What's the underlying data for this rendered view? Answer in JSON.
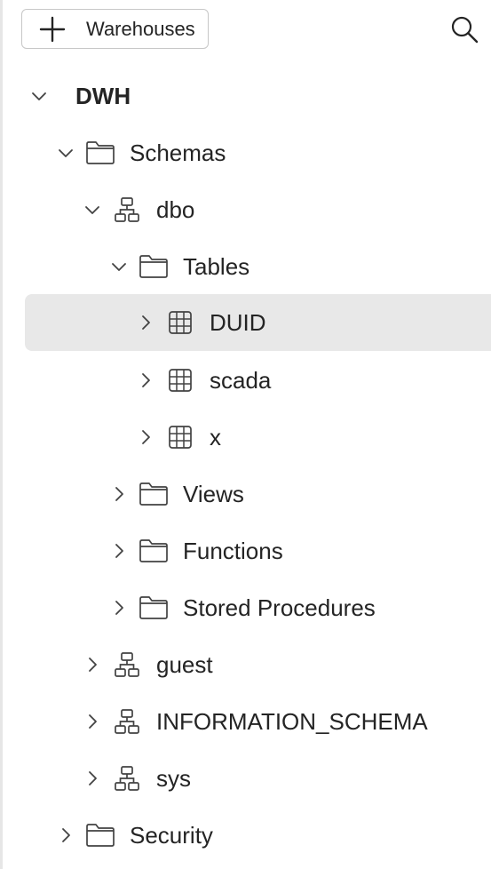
{
  "toolbar": {
    "add_button_label": "Warehouses",
    "add_icon": "plus-icon",
    "search_icon": "search-icon"
  },
  "tree": {
    "root": {
      "label": "DWH",
      "expanded": true
    },
    "schemas_folder": {
      "label": "Schemas",
      "expanded": true
    },
    "dbo": {
      "label": "dbo",
      "expanded": true
    },
    "tables_folder": {
      "label": "Tables",
      "expanded": true
    },
    "tables": [
      {
        "label": "DUID",
        "expanded": false,
        "selected": true
      },
      {
        "label": "scada",
        "expanded": false,
        "selected": false
      },
      {
        "label": "x",
        "expanded": false,
        "selected": false
      }
    ],
    "views_folder": {
      "label": "Views",
      "expanded": false
    },
    "functions_folder": {
      "label": "Functions",
      "expanded": false
    },
    "stored_procedures_folder": {
      "label": "Stored Procedures",
      "expanded": false
    },
    "other_schemas": [
      {
        "label": "guest",
        "expanded": false
      },
      {
        "label": "INFORMATION_SCHEMA",
        "expanded": false
      },
      {
        "label": "sys",
        "expanded": false
      }
    ],
    "security_folder": {
      "label": "Security",
      "expanded": false
    }
  },
  "colors": {
    "selected_row_bg": "#e8e8e8",
    "text": "#242424",
    "icon_stroke": "#424242"
  }
}
